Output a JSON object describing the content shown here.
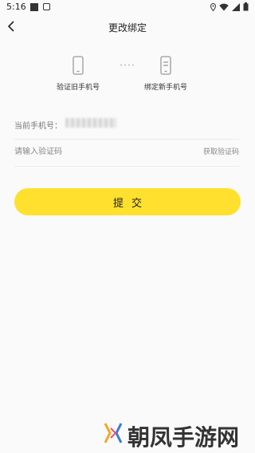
{
  "status_bar": {
    "time": "5:16",
    "icons": [
      "notification-square-icon",
      "notification-box-icon",
      "location-icon",
      "wifi-icon",
      "signal-icon",
      "battery-icon"
    ]
  },
  "header": {
    "title": "更改绑定",
    "back_icon": "chevron-left-icon"
  },
  "steps": [
    {
      "label": "验证旧手机号",
      "icon": "phone-icon"
    },
    {
      "label": "绑定新手机号",
      "icon": "phone-list-icon"
    }
  ],
  "form": {
    "phone_label": "当前手机号：",
    "phone_value_note": "",
    "code_placeholder": "请输入验证码",
    "get_code_label": "获取验证码"
  },
  "submit_label": "提交",
  "watermark": {
    "text": "朝凤手游网"
  },
  "colors": {
    "accent": "#ffe02e",
    "background": "#fafafa",
    "divider": "#ececec",
    "icon_gray": "#9a9a9a"
  }
}
